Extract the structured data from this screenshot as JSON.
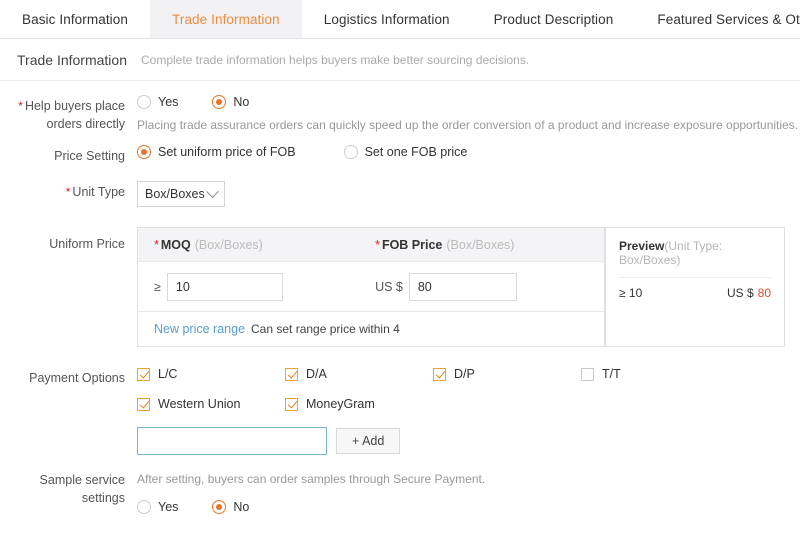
{
  "tabs": [
    {
      "label": "Basic Information",
      "active": false
    },
    {
      "label": "Trade Information",
      "active": true
    },
    {
      "label": "Logistics Information",
      "active": false
    },
    {
      "label": "Product Description",
      "active": false
    },
    {
      "label": "Featured Services & Others",
      "active": false
    }
  ],
  "section": {
    "title": "Trade Information",
    "subtitle": "Complete trade information helps buyers make better sourcing decisions."
  },
  "help_buyers": {
    "label": "Help buyers place orders directly",
    "required": "*",
    "options": [
      {
        "label": "Yes",
        "selected": false
      },
      {
        "label": "No",
        "selected": true
      }
    ],
    "hint": "Placing trade assurance orders can quickly speed up the order conversion of a product and increase exposure opportunities."
  },
  "price_setting": {
    "label": "Price Setting",
    "options": [
      {
        "label": "Set uniform price of FOB",
        "selected": true
      },
      {
        "label": "Set one FOB price",
        "selected": false
      }
    ]
  },
  "unit_type": {
    "label": "Unit Type",
    "required": "*",
    "value": "Box/Boxes",
    "caret": "chevron-down-icon"
  },
  "uniform_price": {
    "label": "Uniform Price",
    "columns": [
      {
        "required": "*",
        "name": "MOQ",
        "unit": "(Box/Boxes)"
      },
      {
        "required": "*",
        "name": "FOB Price",
        "unit": "(Box/Boxes)"
      }
    ],
    "rows": [
      {
        "moq_prefix": "≥",
        "moq_value": "10",
        "fob_prefix": "US $",
        "fob_value": "80"
      }
    ],
    "footer_link": "New price range",
    "footer_note": "Can set range price within 4"
  },
  "preview": {
    "title": "Preview",
    "title_muted": "(Unit Type: Box/Boxes)",
    "qty": "≥ 10",
    "currency": "US $",
    "amount": "80"
  },
  "payment_options": {
    "label": "Payment Options",
    "row1": [
      {
        "label": "L/C",
        "checked": true
      },
      {
        "label": "D/A",
        "checked": true
      },
      {
        "label": "D/P",
        "checked": true
      },
      {
        "label": "T/T",
        "checked": false
      }
    ],
    "row2": [
      {
        "label": "Western Union",
        "checked": true
      },
      {
        "label": "MoneyGram",
        "checked": true
      }
    ],
    "add_input_value": "",
    "add_input_placeholder": "",
    "add_button": "+ Add"
  },
  "sample_service": {
    "label": "Sample service settings",
    "hint": "After setting, buyers can order samples through Secure Payment.",
    "options": [
      {
        "label": "Yes",
        "selected": false
      },
      {
        "label": "No",
        "selected": true
      }
    ]
  },
  "colors": {
    "accent_orange": "#e8732a",
    "tab_active_text": "#ec8b3c",
    "tab_active_bg": "#f2f2f5",
    "required_red": "#e02020",
    "price_red": "#e84b2c",
    "link_blue": "#5a9ec9",
    "focus_border": "#7ab3c9"
  }
}
